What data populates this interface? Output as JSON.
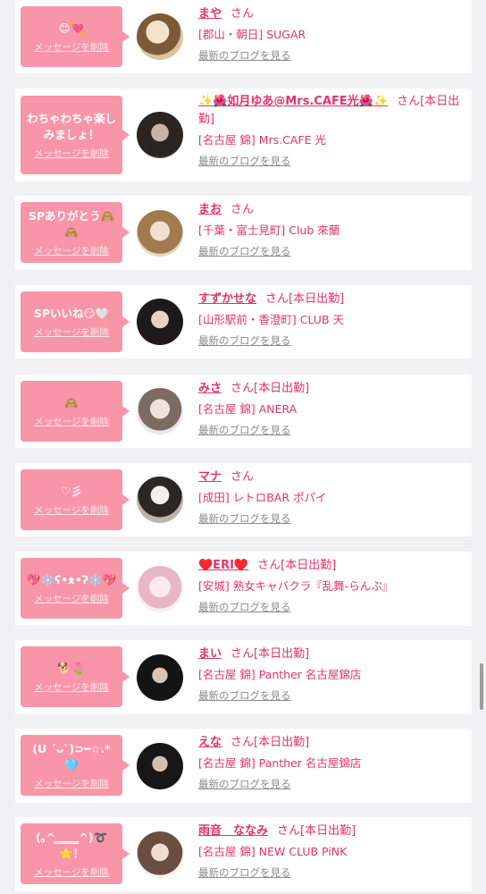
{
  "delete_label": "メッセージを削除",
  "blog_label": "最新のブログを見る",
  "honorific": "さん",
  "colors": {
    "accent": "#e0356a",
    "bubble": "#f995a8",
    "background": "#f1f1f3"
  },
  "items": [
    {
      "message": "😊💘",
      "name": "まや",
      "status": "",
      "shop": "[郡山・朝日] SUGAR",
      "avatar": "portrait-photo"
    },
    {
      "message": "わちゃわちゃ楽しみましょ！",
      "name": "✨🌺如月ゆあ@Mrs.CAFE光🌺✨",
      "status": "[本日出勤]",
      "shop": "[名古屋 錦] Mrs.CAFE 光",
      "avatar": "portrait-photo"
    },
    {
      "message": "SPありがとう🙈🙈",
      "name": "まお",
      "status": "",
      "shop": "[千葉・富士見町] Club 來蘭",
      "avatar": "portrait-photo"
    },
    {
      "message": "SPいいね😏🤍",
      "name": "すずかせな",
      "status": "[本日出勤]",
      "shop": "[山形駅前・香澄町] CLUB 天",
      "avatar": "portrait-photo"
    },
    {
      "message": "🙈",
      "name": "みさ",
      "status": "[本日出勤]",
      "shop": "[名古屋 錦] ANERA",
      "avatar": "portrait-photo"
    },
    {
      "message": "♡彡",
      "name": "マナ",
      "status": "",
      "shop": "[成田] レトロBAR ポパイ",
      "avatar": "portrait-photo"
    },
    {
      "message": "💖❄️ʕ•ᴥ•ʔ❄️💖",
      "name": "♥️ERI♥️",
      "status": "[本日出勤]",
      "shop": "[安城] 熟女キャバクラ『乱舞-らんぶ』",
      "avatar": "portrait-photo"
    },
    {
      "message": "🐕🌷",
      "name": "まい",
      "status": "[本日出勤]",
      "shop": "[名古屋 錦] Panther 名古屋錦店",
      "avatar": "portrait-photo"
    },
    {
      "message": "(U ´ᴗ`)⊃━☆.*🩵",
      "name": "えな",
      "status": "[本日出勤]",
      "shop": "[名古屋 錦] Panther 名古屋錦店",
      "avatar": "portrait-photo"
    },
    {
      "message": "(｡^ ̳ ̳ ̳̳ ̳ ̳ ̳^)➰⭐！",
      "name": "雨音　ななみ",
      "status": "[本日出勤]",
      "shop": "[名古屋 錦] NEW CLUB PiNK",
      "avatar": "portrait-photo"
    }
  ]
}
